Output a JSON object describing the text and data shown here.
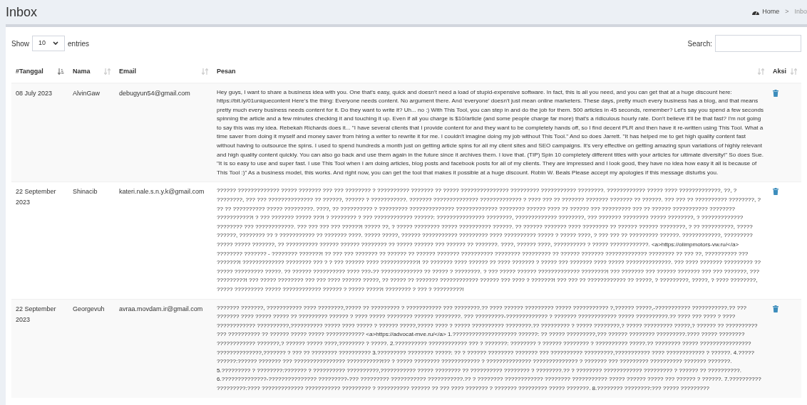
{
  "page_title": "Inbox",
  "breadcrumb": [
    {
      "label": "Home"
    },
    {
      "label": "Inbo"
    }
  ],
  "breadcrumb_separator": ">",
  "length_control": {
    "prefix": "Show",
    "value": "10",
    "suffix": "entries"
  },
  "search": {
    "label": "Search:"
  },
  "table": {
    "columns": [
      {
        "label": "#Tanggal",
        "sorted": true
      },
      {
        "label": "Nama",
        "sorted": false
      },
      {
        "label": "Email",
        "sorted": false
      },
      {
        "label": "Pesan",
        "sorted": false
      },
      {
        "label": "Aksi",
        "sorted": false
      }
    ],
    "rows": [
      {
        "tanggal": "08 July 2023",
        "nama": "AlvinGaw",
        "email": "debugyun54@gmail.com",
        "pesan": "Hey guys, I want to share a business idea with you. One that's easy, quick and doesn't need a load of stupid-expensive software. In fact, this is all you need, and you can get that at a huge discount here: https://bit.ly/01uniquecontent Here's the thing: Everyone needs content. No argument there. And 'everyone' doesn't just mean online marketers. These days, pretty much every business has a blog, and that means pretty much every business needs content for it. Do they want to write it? Uh... no :) With This Tool, you can step in and do the job for them. 500 articles in 45 seconds, remember? Let's say you spend a few seconds spinning the article and a few minutes checking it and touching it up. Even if all you charge is $10/article (and some people charge far more) that's a ridiculous hourly rate. Don't believe it'll be that fast? I'm not going to say this was my idea. Rebekah Richards does it... \"I have several clients that I provide content for and they want to be completely hands off, so I find decent PLR and then have it re-written using This Tool. What a time saver from doing it myself and money saver from hiring a writer to rewrite it for me. I couldn't imagine doing my job without This Tool.\" And so does Jarrett. \"It has helped me to get high quality content fast without having to outsource the spins. I used to spend hundreds a month just on getting article spins for all my client sites and SEO campaigns. It's very effective on getting amazing spun variations of highly relevant and high quality content quickly. You can also go back and use them again in the future since it archives them. I love that. (TIP) Spin 10 completely different titles with your articles for ultimate diversity!\" So does Sue. \"It is so easy to use and super fast. I use This Tool when I am doing articles, blog posts and facebook posts for all of my clients. They are impressed and I look good, they have no idea how easy it all is because of This Tool :)\" As a business model, this works. And right now, you can get the tool that makes it possible at a huge discount. Robin W. Beals Please accept my apologies if this message disturbs you."
      },
      {
        "tanggal": "22 September 2023",
        "nama": "Shinacib",
        "email": "kateri.nale.s.n.y.k@gmail.com",
        "pesan": "?????? ????????????? ????? ??????? ??? ??? ???????? ? ?????????? ??????? ?? ????? ??????????????? ????????? ??????????? ????????. ???????????? ????? ???? ?????????????, ??, ? ????????, ??? ??? ?????????????? ?? ??????, ?????? ? ???????????. ??????? ?????????????? ????????????? ? ???? ??? ?? ??????? ??????? ??????? ?? ??????. ??? ??? ?? ?????????? ????????, ? ?? ?? ?????????? ????? ?????????. ????, ?? ?????????? ? ????????? ?????????????? ????????????? ???????? ?????? ???? ?? ?????? ??? ????????? ??? ?? ?????? ??????????? ???????? ???????????! ? ??? ??????? ????? ???! ? ???????? ? ??? ???????????? ??????: ??????????????? ????????, ????????????? ????????, ??? ??????? ???????? ????? ????????, ? ????????????? ???????? ??? ????????????. ??? ??? ??? ??? ??????! ????? ??, ? ????? ???????? ????? ?????????? ??????. ?? ?????? ??????? ???? ???????? ?? ?????? ?????? ????????, ? ?? ??????????, ????? ??????, ???????? ?? ? ??????????? ?? ??????? ????. ????? ?????, ?????? ??????????? ????????? ???? ?????????? ????? ? ????? ????, ? ??? ??? ?? ????????? ??????. ????????????, ????????? ????? ????? ???????, ?? ?????????? ?????? ?????? ???????? ?? ????? ?????? ??? ?????? ?? ???????. ????, ?????? ????, ?????????? ? ????? ????????????. <a>https://olimpmotors-vw.ru/</a> ???????? ??????? - ???????? ???????! ?? ??? ??? ??????? ?? ?????? ?? ?????? ??????? ?????????? ???????? ????????? ?? ?????? ??????? ????????????? ???????? ?? ??? ??, ?????????? ??? ???????! ????????????? ???????? ??? ? ? ??? ?????? ???? ????????????! ?? ??????? ???? ?????? ?? ???? ??????? ? ????? ??? ??????? ???? ????? ??????????????. ??? ???? ??????? ????????? ?? ????? ????????? ?????. ?? ?????? ?????????? ???? ???-?? ????????????? ?? ????? ? ????????. ? ??? ????? ?????? ????????????? ????????! ??? ??????? ??? ?????? ??????? ??? ??? ???????, ??? ?????????! ??? ????? ???????? ??? ??? ???? ?????? ?????, ?? ????? ?? ??????? ???????????? ?????? ??? ???? ? ???????! ??? ??? ?? ???????????? ?? ?????, ? ?????????, ?????, ? ???? ????????, ????? ????????? ????? ???????????? ?????? ? ????? ?????! ???????? ? ??? ? ?????????!"
      },
      {
        "tanggal": "22 September 2023",
        "nama": "Georgevuh",
        "email": "avraa.movdam.ir@gmail.com",
        "pesan": "??????? ???????, ??????????? ???? ????????,????? ?? ????????? ? ??????????? ??? ????????.?? ???? ?????? ????????? ????? ??????????? ?,?????? ?????,-??????????? ???????????.?? ??? ??????? ???? ????? ????? ?? ????????? ?????? ? ???? ????? ???????? ?????? ????????. ??? ?????????-????????????? ? ??????? ???????????? ????? ??????????.?? ???? ??? ???? ? ???? ???????????? ??????????,?????????? ????? ???? ????? ? ?????? ?????,????? ???? ? ????? ?????????? ????????.?? ????????? ? ????? ????????,? ????? ????????? ?????,? ?????? ?? ?????????? ??? ?????????? ?? ?????? ????? ????? ???????????? <a>https://advocat-mve.ru/</a> 1.???????????????????? ??????: ?? ????? ?????????,??? ?????? ???????? ?????????.???? ????? ???????? ???????????? ???????,? ?????? ????? ????,???????? ? ?????. 2.?????????? ???????????? ??? ? ???????: ???????? ? ?????? ???????? ? ?????????? ?????.?? ???????? ????? ???????????????? ??????????????,??????? ? ??? ?? ???????? ?????????? 3.????????? ???????? ?????: ?? ? ?????? ???????? ??????? ??? ?????????? ?????????,??????????? ???? ???????????? ? ??????. 4.????? ??????:?????? ??????? ??? ???????????????? ???????????!?? ? ????? ???????? ???????????? ? ?????????????? ?????????????? ? ??????? ??? ????????? ?????????? ??????? ???????. 5.????????? ? ????????:??????? ? ?????????? ??????????,??????????? ????? ???????? ?? ?????????? ???????? ? ????????.?? ? ???????? ???????????? ????????? ? ?????? ?? ??????????. 6.??????????????-??????????????? ?????????-??? ????????? ??????????? ???????????.?? ? ???????? ???????????? ???????? ??????????? ????? ?????? ????? ??? ?????? ? ??????. 7.?????????? ?????????:???? ????????????? ??????????? ????????? ? ?????????? ?????? ?? ??? ???? ??????? ? ??????? ????????? ????? ???????. 8.???????? ????????:??? ????? ?????????"
      }
    ]
  }
}
